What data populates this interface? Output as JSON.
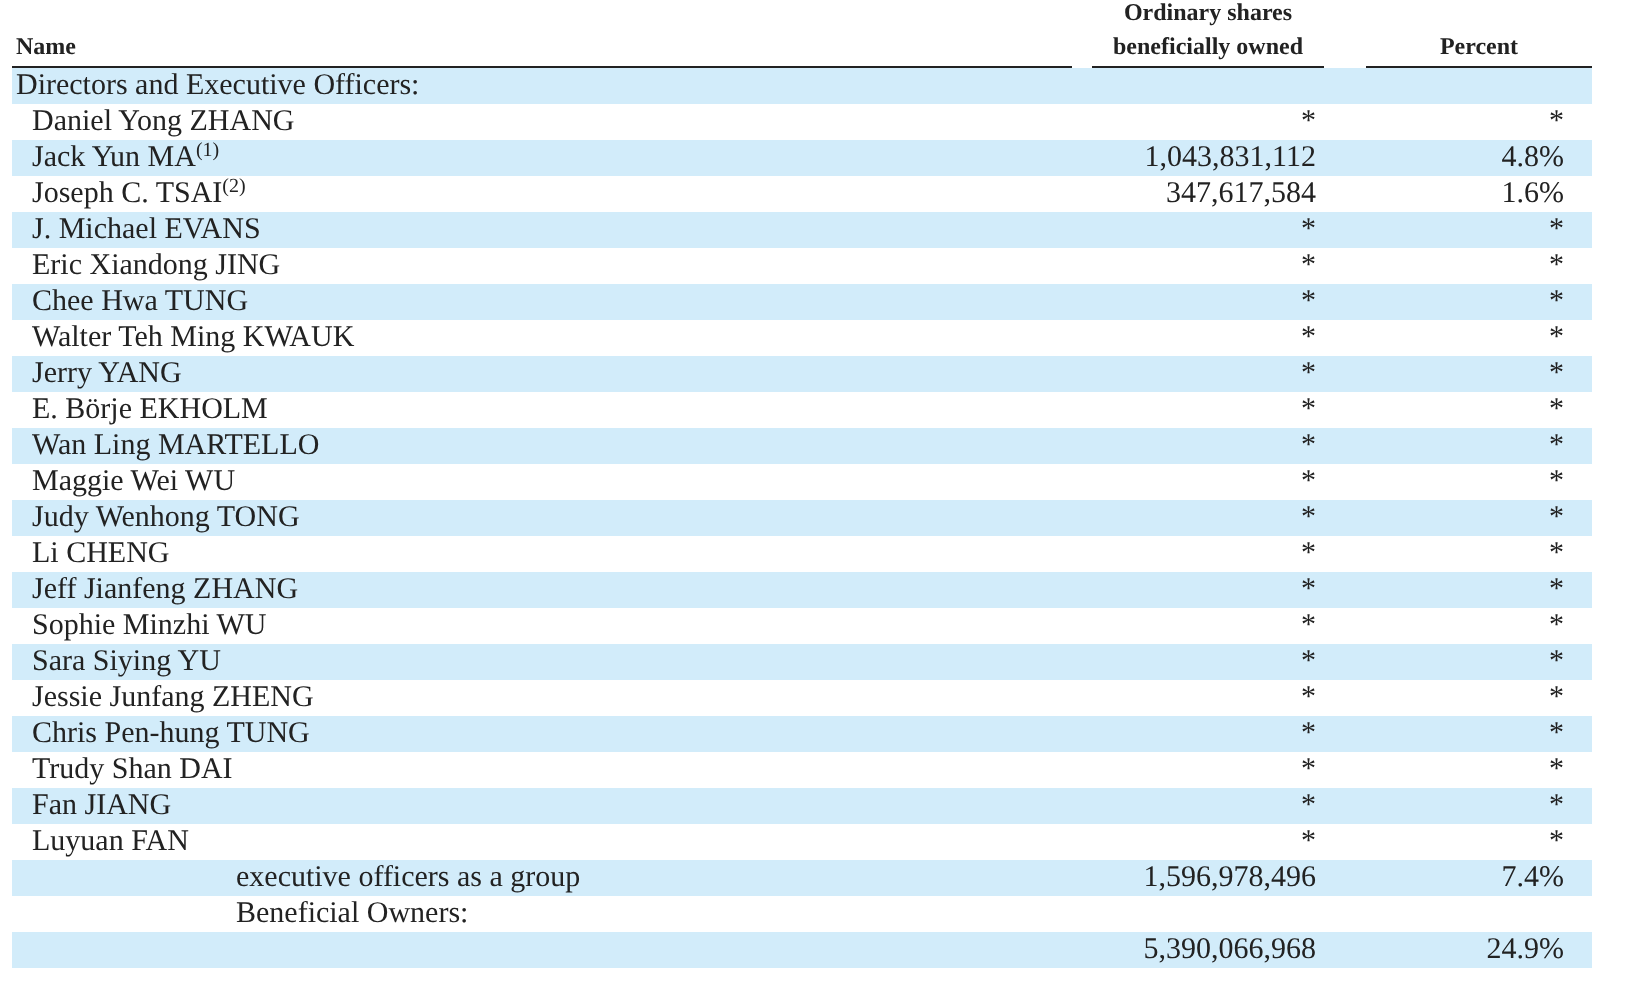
{
  "table": {
    "columns": [
      "Name",
      "Ordinary shares beneficially owned",
      "Percent"
    ],
    "rows": [
      {
        "kind": "section",
        "name": "Directors and Executive Officers:"
      },
      {
        "kind": "person",
        "name": "Daniel Yong ZHANG",
        "shares": "*",
        "percent": "*"
      },
      {
        "kind": "person",
        "name": "Jack Yun MA$^{(1)}$",
        "shares": "1,043,831,112",
        "percent": "4.8%"
      },
      {
        "kind": "person",
        "name": "Joseph C. TSAI$^{(2)}$",
        "shares": "347,617,584",
        "percent": "1.6%"
      },
      {
        "kind": "person",
        "name": "J. Michael EVANS",
        "shares": "*",
        "percent": "*"
      },
      {
        "kind": "person",
        "name": "Eric Xiandong JING",
        "shares": "*",
        "percent": "*"
      },
      {
        "kind": "person",
        "name": "Chee Hwa TUNG",
        "shares": "*",
        "percent": "*"
      },
      {
        "kind": "person",
        "name": "Walter Teh Ming KWAUK",
        "shares": "*",
        "percent": "*"
      },
      {
        "kind": "person",
        "name": "Jerry YANG",
        "shares": "*",
        "percent": "*"
      },
      {
        "kind": "person",
        "name": "E. Börje EKHOLM",
        "shares": "*",
        "percent": "*"
      },
      {
        "kind": "person",
        "name": "Wan Ling MARTELLO",
        "shares": "*",
        "percent": "*"
      },
      {
        "kind": "person",
        "name": "Maggie Wei WU",
        "shares": "*",
        "percent": "*"
      },
      {
        "kind": "person",
        "name": "Judy Wenhong TONG",
        "shares": "*",
        "percent": "*"
      },
      {
        "kind": "person",
        "name": "Li CHENG",
        "shares": "*",
        "percent": "*"
      },
      {
        "kind": "person",
        "name": "Jeff Jianfeng ZHANG",
        "shares": "*",
        "percent": "*"
      },
      {
        "kind": "person",
        "name": "Sophie Minzhi WU",
        "shares": "*",
        "percent": "*"
      },
      {
        "kind": "person",
        "name": "Sara Siying YU",
        "shares": "*",
        "percent": "*"
      },
      {
        "kind": "person",
        "name": "Jessie Junfang ZHENG",
        "shares": "*",
        "percent": "*"
      },
      {
        "kind": "person",
        "name": "Chris Pen-hung TUNG",
        "shares": "*",
        "percent": "*"
      },
      {
        "kind": "person",
        "name": "Trudy Shan DAI",
        "shares": "*",
        "percent": "*"
      },
      {
        "kind": "person",
        "name": "Fan JIANG",
        "shares": "*",
        "percent": "*"
      },
      {
        "kind": "person",
        "name": "Luyuan FAN",
        "shares": "*",
        "percent": "*"
      },
      {
        "kind": "partial",
        "name": "executive officers as a group",
        "shares": "1,596,978,496",
        "percent": "7.4%"
      },
      {
        "kind": "partial",
        "name": "Beneficial Owners:"
      },
      {
        "kind": "partial",
        "shares": "5,390,066,968",
        "percent": "24.9%"
      }
    ]
  }
}
